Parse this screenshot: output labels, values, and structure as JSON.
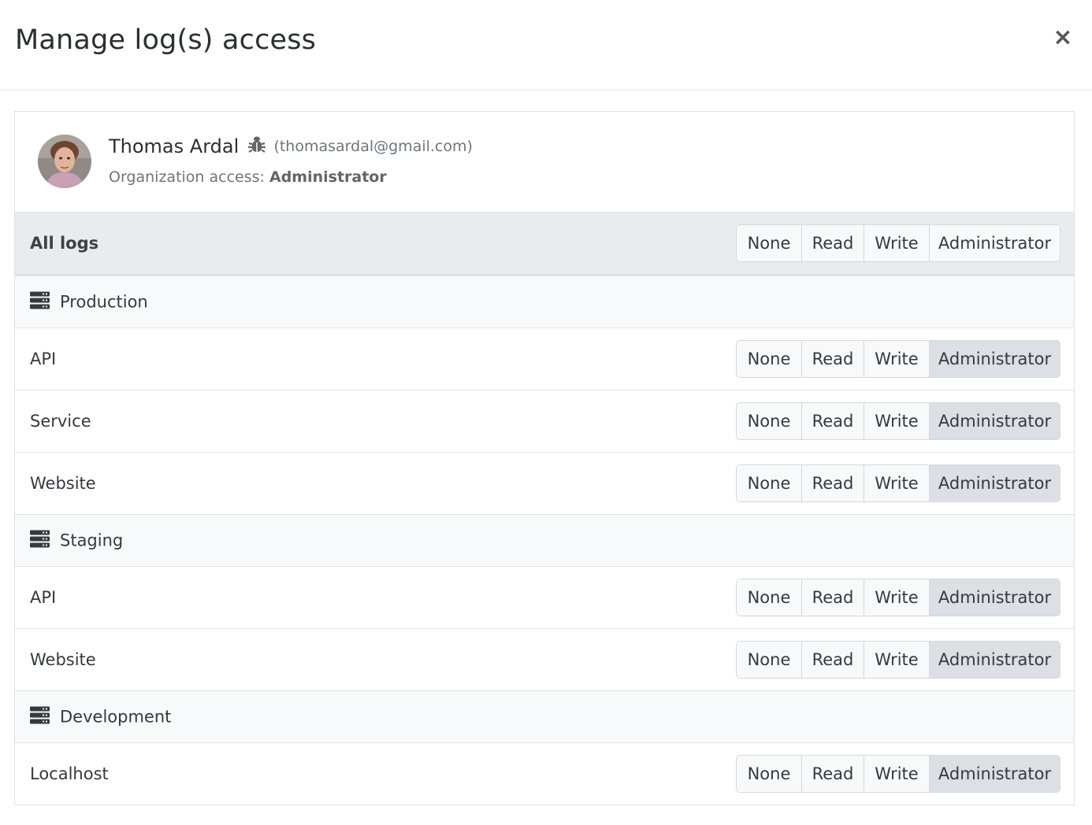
{
  "modal": {
    "title": "Manage log(s) access",
    "close_label": "×"
  },
  "user": {
    "name": "Thomas Ardal",
    "email": "(thomasardal@gmail.com)",
    "org_access_label": "Organization access:",
    "org_access_value": "Administrator"
  },
  "options": [
    "None",
    "Read",
    "Write",
    "Administrator"
  ],
  "all_logs": {
    "label": "All logs",
    "selected": ""
  },
  "groups": [
    {
      "name": "Production",
      "icon": "server-icon",
      "logs": [
        {
          "label": "API",
          "selected": "Administrator"
        },
        {
          "label": "Service",
          "selected": "Administrator"
        },
        {
          "label": "Website",
          "selected": "Administrator"
        }
      ]
    },
    {
      "name": "Staging",
      "icon": "server-icon",
      "logs": [
        {
          "label": "API",
          "selected": "Administrator"
        },
        {
          "label": "Website",
          "selected": "Administrator"
        }
      ]
    },
    {
      "name": "Development",
      "icon": "server-icon",
      "logs": [
        {
          "label": "Localhost",
          "selected": "Administrator"
        }
      ]
    }
  ],
  "colors": {
    "active_button": "#dcdfe3",
    "header_row": "#e9ecef",
    "group_row": "#f8f9fa"
  }
}
